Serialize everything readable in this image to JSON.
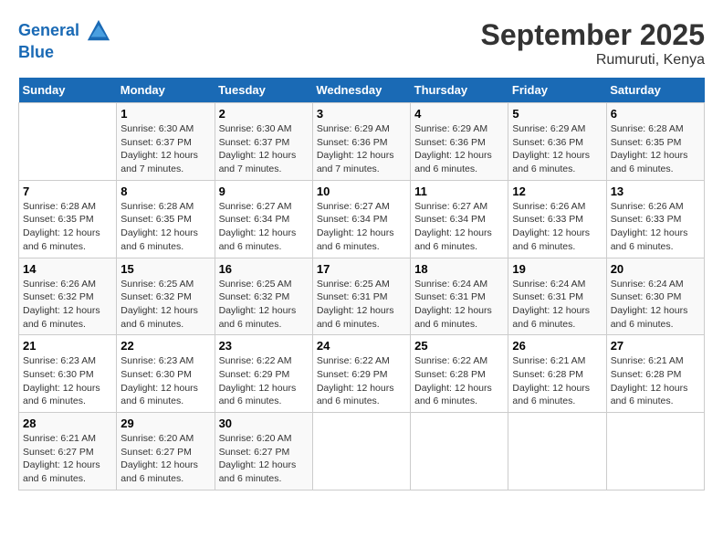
{
  "header": {
    "logo_line1": "General",
    "logo_line2": "Blue",
    "month": "September 2025",
    "location": "Rumuruti, Kenya"
  },
  "days_of_week": [
    "Sunday",
    "Monday",
    "Tuesday",
    "Wednesday",
    "Thursday",
    "Friday",
    "Saturday"
  ],
  "weeks": [
    [
      {
        "day": "",
        "sunrise": "",
        "sunset": "",
        "daylight": ""
      },
      {
        "day": "1",
        "sunrise": "Sunrise: 6:30 AM",
        "sunset": "Sunset: 6:37 PM",
        "daylight": "Daylight: 12 hours and 7 minutes."
      },
      {
        "day": "2",
        "sunrise": "Sunrise: 6:30 AM",
        "sunset": "Sunset: 6:37 PM",
        "daylight": "Daylight: 12 hours and 7 minutes."
      },
      {
        "day": "3",
        "sunrise": "Sunrise: 6:29 AM",
        "sunset": "Sunset: 6:36 PM",
        "daylight": "Daylight: 12 hours and 7 minutes."
      },
      {
        "day": "4",
        "sunrise": "Sunrise: 6:29 AM",
        "sunset": "Sunset: 6:36 PM",
        "daylight": "Daylight: 12 hours and 6 minutes."
      },
      {
        "day": "5",
        "sunrise": "Sunrise: 6:29 AM",
        "sunset": "Sunset: 6:36 PM",
        "daylight": "Daylight: 12 hours and 6 minutes."
      },
      {
        "day": "6",
        "sunrise": "Sunrise: 6:28 AM",
        "sunset": "Sunset: 6:35 PM",
        "daylight": "Daylight: 12 hours and 6 minutes."
      }
    ],
    [
      {
        "day": "7",
        "sunrise": "Sunrise: 6:28 AM",
        "sunset": "Sunset: 6:35 PM",
        "daylight": "Daylight: 12 hours and 6 minutes."
      },
      {
        "day": "8",
        "sunrise": "Sunrise: 6:28 AM",
        "sunset": "Sunset: 6:35 PM",
        "daylight": "Daylight: 12 hours and 6 minutes."
      },
      {
        "day": "9",
        "sunrise": "Sunrise: 6:27 AM",
        "sunset": "Sunset: 6:34 PM",
        "daylight": "Daylight: 12 hours and 6 minutes."
      },
      {
        "day": "10",
        "sunrise": "Sunrise: 6:27 AM",
        "sunset": "Sunset: 6:34 PM",
        "daylight": "Daylight: 12 hours and 6 minutes."
      },
      {
        "day": "11",
        "sunrise": "Sunrise: 6:27 AM",
        "sunset": "Sunset: 6:34 PM",
        "daylight": "Daylight: 12 hours and 6 minutes."
      },
      {
        "day": "12",
        "sunrise": "Sunrise: 6:26 AM",
        "sunset": "Sunset: 6:33 PM",
        "daylight": "Daylight: 12 hours and 6 minutes."
      },
      {
        "day": "13",
        "sunrise": "Sunrise: 6:26 AM",
        "sunset": "Sunset: 6:33 PM",
        "daylight": "Daylight: 12 hours and 6 minutes."
      }
    ],
    [
      {
        "day": "14",
        "sunrise": "Sunrise: 6:26 AM",
        "sunset": "Sunset: 6:32 PM",
        "daylight": "Daylight: 12 hours and 6 minutes."
      },
      {
        "day": "15",
        "sunrise": "Sunrise: 6:25 AM",
        "sunset": "Sunset: 6:32 PM",
        "daylight": "Daylight: 12 hours and 6 minutes."
      },
      {
        "day": "16",
        "sunrise": "Sunrise: 6:25 AM",
        "sunset": "Sunset: 6:32 PM",
        "daylight": "Daylight: 12 hours and 6 minutes."
      },
      {
        "day": "17",
        "sunrise": "Sunrise: 6:25 AM",
        "sunset": "Sunset: 6:31 PM",
        "daylight": "Daylight: 12 hours and 6 minutes."
      },
      {
        "day": "18",
        "sunrise": "Sunrise: 6:24 AM",
        "sunset": "Sunset: 6:31 PM",
        "daylight": "Daylight: 12 hours and 6 minutes."
      },
      {
        "day": "19",
        "sunrise": "Sunrise: 6:24 AM",
        "sunset": "Sunset: 6:31 PM",
        "daylight": "Daylight: 12 hours and 6 minutes."
      },
      {
        "day": "20",
        "sunrise": "Sunrise: 6:24 AM",
        "sunset": "Sunset: 6:30 PM",
        "daylight": "Daylight: 12 hours and 6 minutes."
      }
    ],
    [
      {
        "day": "21",
        "sunrise": "Sunrise: 6:23 AM",
        "sunset": "Sunset: 6:30 PM",
        "daylight": "Daylight: 12 hours and 6 minutes."
      },
      {
        "day": "22",
        "sunrise": "Sunrise: 6:23 AM",
        "sunset": "Sunset: 6:30 PM",
        "daylight": "Daylight: 12 hours and 6 minutes."
      },
      {
        "day": "23",
        "sunrise": "Sunrise: 6:22 AM",
        "sunset": "Sunset: 6:29 PM",
        "daylight": "Daylight: 12 hours and 6 minutes."
      },
      {
        "day": "24",
        "sunrise": "Sunrise: 6:22 AM",
        "sunset": "Sunset: 6:29 PM",
        "daylight": "Daylight: 12 hours and 6 minutes."
      },
      {
        "day": "25",
        "sunrise": "Sunrise: 6:22 AM",
        "sunset": "Sunset: 6:28 PM",
        "daylight": "Daylight: 12 hours and 6 minutes."
      },
      {
        "day": "26",
        "sunrise": "Sunrise: 6:21 AM",
        "sunset": "Sunset: 6:28 PM",
        "daylight": "Daylight: 12 hours and 6 minutes."
      },
      {
        "day": "27",
        "sunrise": "Sunrise: 6:21 AM",
        "sunset": "Sunset: 6:28 PM",
        "daylight": "Daylight: 12 hours and 6 minutes."
      }
    ],
    [
      {
        "day": "28",
        "sunrise": "Sunrise: 6:21 AM",
        "sunset": "Sunset: 6:27 PM",
        "daylight": "Daylight: 12 hours and 6 minutes."
      },
      {
        "day": "29",
        "sunrise": "Sunrise: 6:20 AM",
        "sunset": "Sunset: 6:27 PM",
        "daylight": "Daylight: 12 hours and 6 minutes."
      },
      {
        "day": "30",
        "sunrise": "Sunrise: 6:20 AM",
        "sunset": "Sunset: 6:27 PM",
        "daylight": "Daylight: 12 hours and 6 minutes."
      },
      {
        "day": "",
        "sunrise": "",
        "sunset": "",
        "daylight": ""
      },
      {
        "day": "",
        "sunrise": "",
        "sunset": "",
        "daylight": ""
      },
      {
        "day": "",
        "sunrise": "",
        "sunset": "",
        "daylight": ""
      },
      {
        "day": "",
        "sunrise": "",
        "sunset": "",
        "daylight": ""
      }
    ]
  ]
}
